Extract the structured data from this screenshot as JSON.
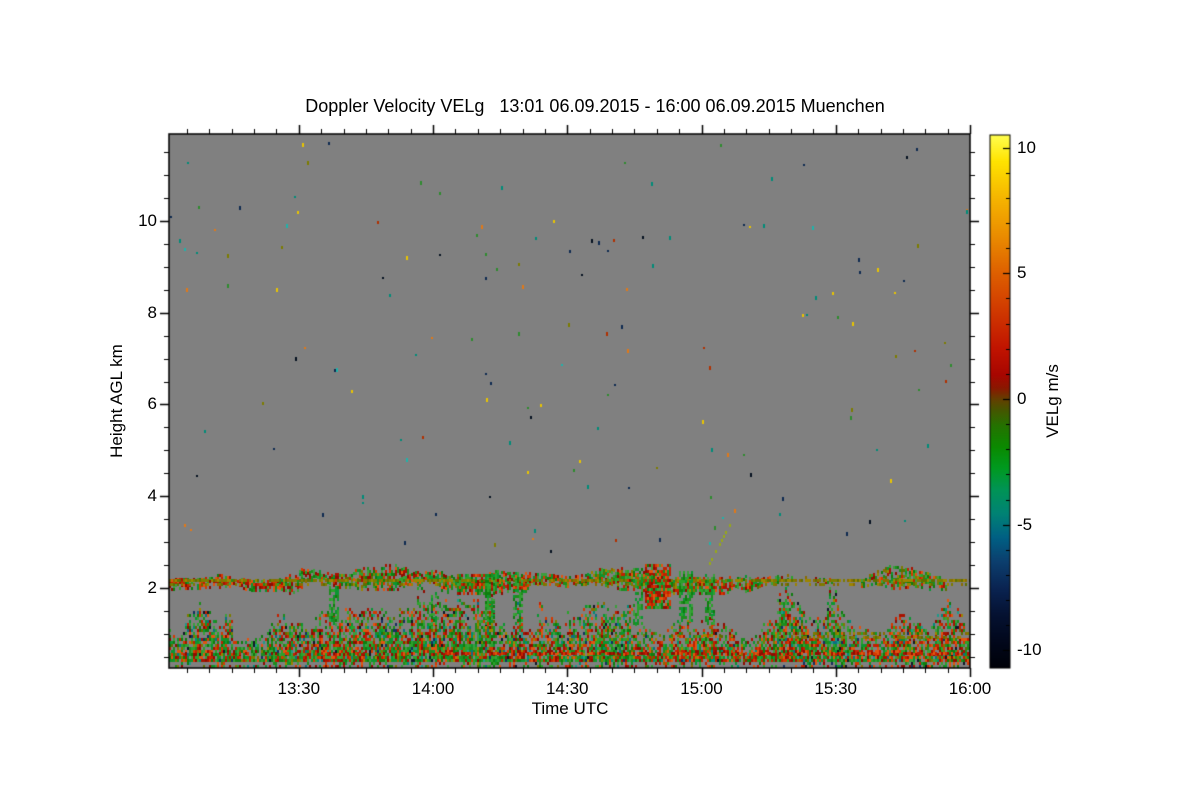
{
  "chart_data": {
    "type": "heatmap",
    "title": "Doppler Velocity VELg   13:01 06.09.2015 - 16:00 06.09.2015 Muenchen",
    "xlabel": "Time UTC",
    "ylabel": "Height AGL km",
    "colorbar_label": "VELg m/s",
    "x_axis": {
      "start_min": 781,
      "end_min": 960,
      "minor_step_min": 5,
      "major_ticks": [
        {
          "label": "13:30",
          "min": 810
        },
        {
          "label": "14:00",
          "min": 840
        },
        {
          "label": "14:30",
          "min": 870
        },
        {
          "label": "15:00",
          "min": 900
        },
        {
          "label": "15:30",
          "min": 930
        },
        {
          "label": "16:00",
          "min": 960
        }
      ]
    },
    "y_axis": {
      "min_km": 0.25,
      "max_km": 11.9,
      "minor_step_km": 0.5,
      "major_ticks": [
        {
          "label": "2",
          "km": 2
        },
        {
          "label": "4",
          "km": 4
        },
        {
          "label": "6",
          "km": 6
        },
        {
          "label": "8",
          "km": 8
        },
        {
          "label": "10",
          "km": 10
        }
      ]
    },
    "colorbar": {
      "min": -10.7,
      "max": 10.5,
      "minor_step": 1,
      "major_ticks": [
        {
          "label": "10",
          "value": 10
        },
        {
          "label": "5",
          "value": 5
        },
        {
          "label": "0",
          "value": 0
        },
        {
          "label": "-5",
          "value": -5
        },
        {
          "label": "-10",
          "value": -10
        }
      ],
      "gradient_stops": [
        [
          0,
          "#ffff50"
        ],
        [
          0.05,
          "#ffe300"
        ],
        [
          0.12,
          "#f5b400"
        ],
        [
          0.19,
          "#ea8c00"
        ],
        [
          0.26,
          "#de5f00"
        ],
        [
          0.33,
          "#d03900"
        ],
        [
          0.4,
          "#c11400"
        ],
        [
          0.45,
          "#a80600"
        ],
        [
          0.475,
          "#8a1800"
        ],
        [
          0.495,
          "#653e00"
        ],
        [
          0.515,
          "#475500"
        ],
        [
          0.545,
          "#257200"
        ],
        [
          0.585,
          "#0b8a00"
        ],
        [
          0.625,
          "#009a20"
        ],
        [
          0.665,
          "#009455"
        ],
        [
          0.71,
          "#008374"
        ],
        [
          0.755,
          "#006084"
        ],
        [
          0.8,
          "#0c3f6e"
        ],
        [
          0.85,
          "#0a2452"
        ],
        [
          0.9,
          "#051232"
        ],
        [
          0.95,
          "#02081c"
        ],
        [
          1,
          "#000108"
        ]
      ]
    },
    "field": {
      "background": "#808080",
      "seed": 1337,
      "cell": {
        "w": 2,
        "h": 3
      },
      "palette": {
        "greens": [
          "#1e8c1e",
          "#0f7d0f",
          "#2ba22b",
          "#0c9632",
          "#3d9e3d"
        ],
        "reds": [
          "#c32000",
          "#a81200",
          "#d33a00",
          "#8f0c00",
          "#e05510"
        ],
        "olives": [
          "#7c7c00",
          "#8a6c00",
          "#5f6e00",
          "#9c8400"
        ],
        "teals": [
          "#008c78",
          "#0e6f82",
          "#1f9a8a"
        ],
        "darks": [
          "#143060",
          "#101828"
        ]
      },
      "surface_band": {
        "top_base": 1.35,
        "top_var": 0.5,
        "base_km": 0.26,
        "fill_max": 0.97,
        "fill_falloff": 0.8
      },
      "cloud_band": {
        "threshold": 0.33,
        "center": 2.15,
        "line_km": 2.15,
        "line_p": 0.72,
        "line2_km": 2.07,
        "line2_p": 0.3,
        "patches": [
          {
            "t0": 0.0,
            "t1": 0.16,
            "half": 0.13,
            "density": 0.8,
            "red": 0.15
          },
          {
            "t0": 0.17,
            "t1": 0.27,
            "half": 0.1,
            "density": 0.7,
            "red": 0.1
          },
          {
            "t0": 0.36,
            "t1": 0.45,
            "half": 0.22,
            "density": 0.92,
            "red": 0.22,
            "center": 2.12
          },
          {
            "t0": 0.45,
            "t1": 0.52,
            "half": 0.12,
            "density": 0.75,
            "red": 0.05
          },
          {
            "t0": 0.56,
            "t1": 0.6,
            "half": 0.16,
            "density": 0.8,
            "red": 0.1
          },
          {
            "t0": 0.63,
            "t1": 0.7,
            "half": 0.18,
            "density": 0.8,
            "red": 0.05
          }
        ]
      },
      "blobs": [
        {
          "t0": 0.595,
          "t1": 0.625,
          "h0": 1.55,
          "h1": 2.47,
          "density": 0.85,
          "red": 0.72
        }
      ],
      "plumes": [
        {
          "t": 0.205,
          "hw": 0.006,
          "top": 2.0
        },
        {
          "t": 0.33,
          "hw": 0.005,
          "top": 1.9
        },
        {
          "t": 0.4,
          "hw": 0.007,
          "top": 2.25
        },
        {
          "t": 0.435,
          "hw": 0.006,
          "top": 2.3
        },
        {
          "t": 0.585,
          "hw": 0.007,
          "top": 2.4
        },
        {
          "t": 0.645,
          "hw": 0.008,
          "top": 2.35
        },
        {
          "t": 0.675,
          "hw": 0.006,
          "top": 2.3
        }
      ],
      "streaks": [
        {
          "t0": 0.33,
          "t1": 1.0,
          "km": 0.55,
          "p": 0.55,
          "colors": "reds"
        },
        {
          "t0": 0.0,
          "t1": 0.33,
          "km": 0.55,
          "p": 0.2,
          "colors": "reds"
        },
        {
          "t0": 0.76,
          "t1": 1.0,
          "km": 0.9,
          "p": 0.5,
          "colors": "olives"
        },
        {
          "t0": 0.76,
          "t1": 1.0,
          "km": 0.99,
          "p": 0.3,
          "colors": "olives"
        },
        {
          "t0": 0.5,
          "t1": 0.76,
          "km": 0.95,
          "p": 0.15,
          "colors": "olives"
        }
      ],
      "diagonal": {
        "t0": 0.668,
        "t1": 0.7,
        "h0": 2.3,
        "h1": 3.35,
        "color": "#97a81a"
      },
      "speckles": {
        "seed": 99,
        "count": 150,
        "h_min": 2.6,
        "h_max": 11.8,
        "colors": [
          {
            "c": "#0e2a50",
            "w": 12
          },
          {
            "c": "#05101f",
            "w": 10
          },
          {
            "c": "#008c78",
            "w": 16
          },
          {
            "c": "#20b2aa",
            "w": 4
          },
          {
            "c": "#e8c400",
            "w": 12
          },
          {
            "c": "#e07818",
            "w": 14
          },
          {
            "c": "#b03000",
            "w": 10
          },
          {
            "c": "#2e8b2e",
            "w": 12
          },
          {
            "c": "#7c7c00",
            "w": 10
          }
        ]
      }
    }
  }
}
